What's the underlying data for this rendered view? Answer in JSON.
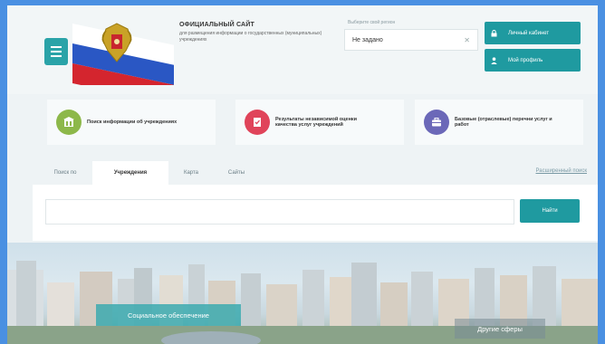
{
  "header": {
    "title": "ОФИЦИАЛЬНЫЙ САЙТ",
    "subtitle": "для размещения информации о государственных (муниципальных) учреждениях",
    "region_label": "Выберите свой регион",
    "region_value": "Не задано",
    "login_button": "Личный кабинет",
    "profile_button": "Мой профиль"
  },
  "services": [
    {
      "label": "Поиск информации об учреждениях",
      "color": "#8db84a"
    },
    {
      "label": "Результаты независимой оценки качества услуг учреждений",
      "color": "#e0445a"
    },
    {
      "label": "Базовые (отраслевые) перечни услуг и работ",
      "color": "#6b68b8"
    }
  ],
  "tabs": [
    {
      "label": "Поиск по"
    },
    {
      "label": "Учреждения"
    },
    {
      "label": "Карта"
    },
    {
      "label": "Сайты"
    }
  ],
  "advanced_search": "Расширенный поиск",
  "search": {
    "placeholder": "",
    "button": "Найти"
  },
  "banner": {
    "tag_left": "Социальное обеспечение",
    "tag_right": "Другие сферы"
  },
  "colors": {
    "accent": "#1f9aa0",
    "background": "#eef3f5",
    "frame": "#4a90e2"
  }
}
